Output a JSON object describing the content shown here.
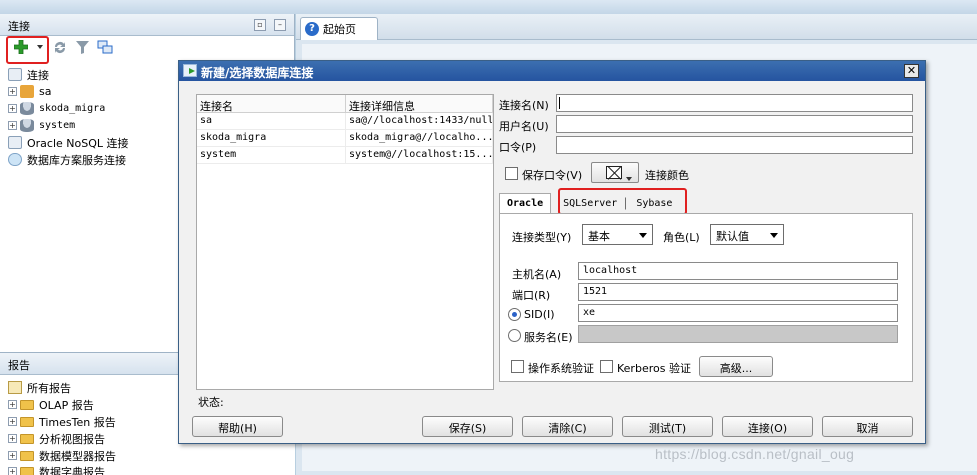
{
  "left_panel": {
    "title": "连接",
    "tree": [
      {
        "label": "连接",
        "expander": ""
      },
      {
        "label": "sa",
        "expander": "+"
      },
      {
        "label": "skoda_migra",
        "expander": "+"
      },
      {
        "label": "system",
        "expander": "+"
      },
      {
        "label": "Oracle NoSQL 连接",
        "expander": ""
      },
      {
        "label": "数据库方案服务连接",
        "expander": ""
      }
    ]
  },
  "reports_panel": {
    "title": "报告",
    "items": [
      {
        "label": "所有报告",
        "expander": ""
      },
      {
        "label": "OLAP 报告",
        "expander": "+"
      },
      {
        "label": "TimesTen 报告",
        "expander": "+"
      },
      {
        "label": "分析视图报告",
        "expander": "+"
      },
      {
        "label": "数据模型器报告",
        "expander": "+"
      },
      {
        "label": "数据字典报告",
        "expander": "+"
      }
    ]
  },
  "editor": {
    "tab_label": "起始页",
    "tab_icon": "?"
  },
  "dialog": {
    "title": "新建/选择数据库连接",
    "close_glyph": "✕",
    "table": {
      "headers": [
        "连接名",
        "连接详细信息"
      ],
      "rows": [
        [
          "sa",
          "sa@//localhost:1433/null"
        ],
        [
          "skoda_migra",
          "skoda_migra@//localho..."
        ],
        [
          "system",
          "system@//localhost:15..."
        ]
      ]
    },
    "fields": {
      "conn_name_label": "连接名(N)",
      "conn_name_value": "",
      "username_label": "用户名(U)",
      "username_value": "",
      "password_label": "口令(P)",
      "password_value": "",
      "save_password_label": "保存口令(V)",
      "conn_color_label": "连接颜色"
    },
    "tabs": [
      "Oracle",
      "SQLServer",
      "Sybase"
    ],
    "oracle": {
      "conn_type_label": "连接类型(Y)",
      "conn_type_value": "基本",
      "role_label": "角色(L)",
      "role_value": "默认值",
      "host_label": "主机名(A)",
      "host_value": "localhost",
      "port_label": "端口(R)",
      "port_value": "1521",
      "sid_label": "SID(I)",
      "sid_value": "xe",
      "service_label": "服务名(E)",
      "service_value": "",
      "os_auth_label": "操作系统验证",
      "kerberos_label": "Kerberos 验证",
      "advanced_label": "高级..."
    },
    "status_label": "状态:",
    "buttons": {
      "help": "帮助(H)",
      "save": "保存(S)",
      "clear": "清除(C)",
      "test": "测试(T)",
      "connect": "连接(O)",
      "cancel": "取消"
    }
  },
  "watermark": "https://blog.csdn.net/gnail_oug",
  "colors": {
    "title_bar": "#2554a0",
    "highlight_box": "#e02020",
    "add_icon": "#2a9a2a"
  }
}
